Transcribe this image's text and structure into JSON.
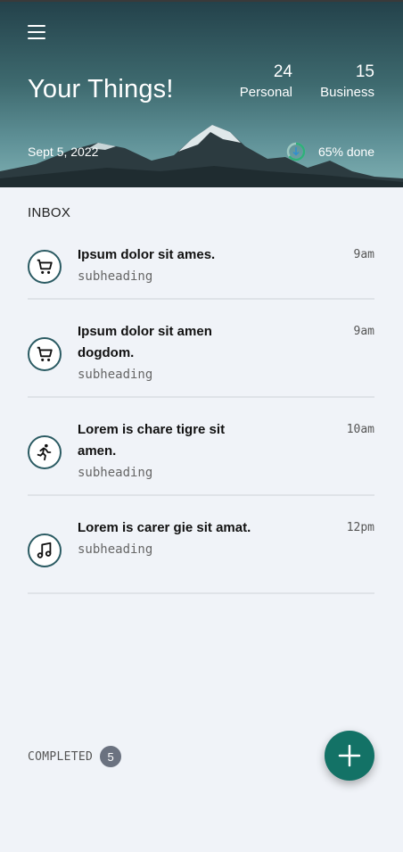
{
  "header": {
    "title": "Your Things!",
    "date": "Sept 5, 2022",
    "progress": {
      "fraction": 0.65,
      "label": "65% done"
    },
    "stats": [
      {
        "value": "24",
        "label": "Personal"
      },
      {
        "value": "15",
        "label": "Business"
      }
    ]
  },
  "inbox": {
    "label": "INBOX",
    "items": [
      {
        "icon": "cart-icon",
        "title": "Ipsum dolor sit ames.",
        "subheading": "subheading",
        "time": "9am"
      },
      {
        "icon": "cart-icon",
        "title": "Ipsum dolor sit amen dogdom.",
        "subheading": "subheading",
        "time": "9am"
      },
      {
        "icon": "running-icon",
        "title": "Lorem is chare tigre sit amen.",
        "subheading": "subheading",
        "time": "10am"
      },
      {
        "icon": "music-icon",
        "title": "Lorem is carer gie sit amat.",
        "subheading": "subheading",
        "time": "12pm"
      }
    ]
  },
  "completed": {
    "label": "COMPLETED",
    "count": "5"
  },
  "colors": {
    "accent": "#137266",
    "icon_border": "#2b5b63",
    "badge": "#6b7280",
    "background": "#f0f3f8"
  }
}
